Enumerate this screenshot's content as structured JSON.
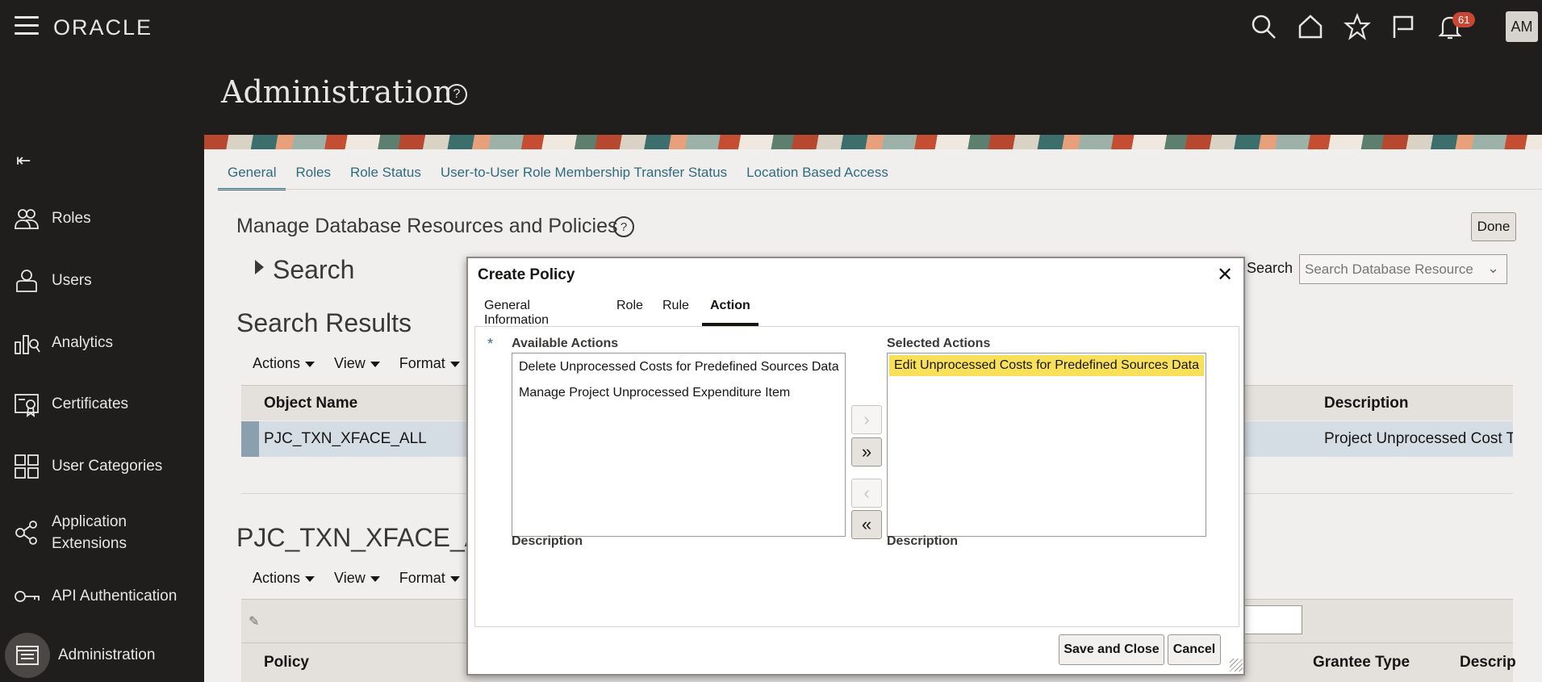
{
  "topbar": {
    "logo": "ORACLE",
    "notif_count": "61",
    "avatar_initials": "AM"
  },
  "icons": [
    "menu-icon",
    "search-icon",
    "home-icon",
    "star-icon",
    "flag-icon",
    "bell-icon"
  ],
  "sidebar": {
    "items": [
      {
        "label": "Roles"
      },
      {
        "label": "Users"
      },
      {
        "label": "Analytics"
      },
      {
        "label": "Certificates"
      },
      {
        "label": "User Categories"
      },
      {
        "label": "Application Extensions"
      },
      {
        "label": "API Authentication"
      },
      {
        "label": "Administration"
      }
    ]
  },
  "page": {
    "title": "Administration"
  },
  "tabs": [
    "General",
    "Roles",
    "Role Status",
    "User-to-User Role Membership Transfer Status",
    "Location Based Access"
  ],
  "main": {
    "section_title": "Manage Database Resources and Policies",
    "done_label": "Done",
    "search_toggle": "Search",
    "search_label": "Search",
    "search_placeholder": "Search Database Resource",
    "results_title": "Search Results",
    "toolbar": {
      "actions": "Actions",
      "view": "View",
      "format": "Format"
    },
    "results_columns": {
      "object_name": "Object Name",
      "description": "Description"
    },
    "results_row": {
      "object_name": "PJC_TXN_XFACE_ALL",
      "description": "Project Unprocessed Cost Tr"
    },
    "detail_title": "PJC_TXN_XFACE_ALL",
    "policy_columns": {
      "policy": "Policy",
      "grantee_type": "Grantee Type",
      "description": "Descrip"
    }
  },
  "modal": {
    "title": "Create Policy",
    "tabs": [
      "General Information",
      "Role",
      "Rule",
      "Action"
    ],
    "available_label": "Available Actions",
    "selected_label": "Selected Actions",
    "available_items": [
      "Delete Unprocessed Costs for Predefined Sources Data",
      "Manage Project Unprocessed Expenditure Item"
    ],
    "selected_items": [
      "Edit Unprocessed Costs for Predefined Sources Data"
    ],
    "description_label": "Description",
    "required_mark": "*",
    "save_close": "Save and Close",
    "cancel": "Cancel"
  }
}
